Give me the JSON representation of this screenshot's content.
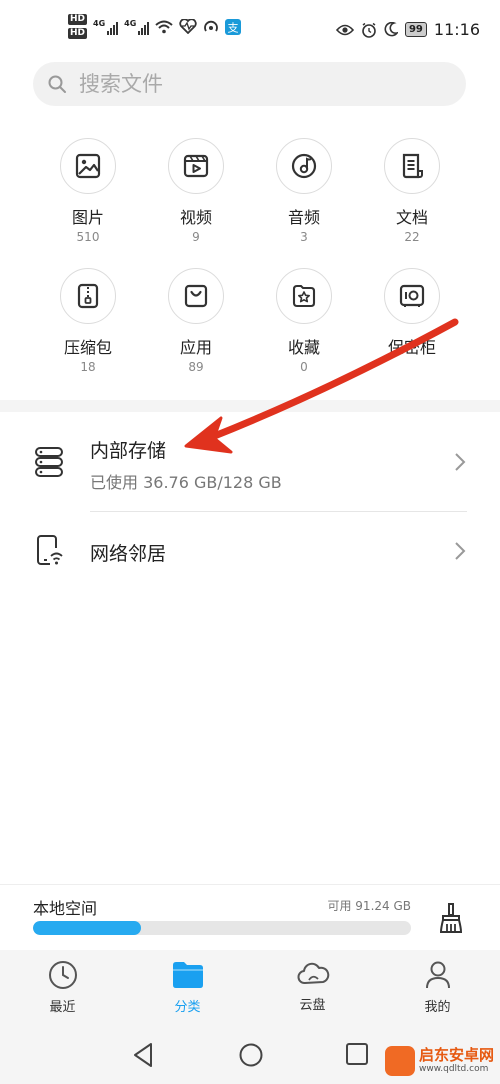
{
  "status_bar": {
    "hd1": "HD",
    "hd2": "HD",
    "net1": "4G",
    "net2": "4G",
    "battery": "99",
    "time": "11:16"
  },
  "search": {
    "placeholder": "搜索文件"
  },
  "categories": [
    {
      "name": "图片",
      "count": "510",
      "icon": "image-icon"
    },
    {
      "name": "视频",
      "count": "9",
      "icon": "video-icon"
    },
    {
      "name": "音频",
      "count": "3",
      "icon": "audio-icon"
    },
    {
      "name": "文档",
      "count": "22",
      "icon": "document-icon"
    },
    {
      "name": "压缩包",
      "count": "18",
      "icon": "archive-icon"
    },
    {
      "name": "应用",
      "count": "89",
      "icon": "app-bag-icon"
    },
    {
      "name": "收藏",
      "count": "0",
      "icon": "favorite-star-icon"
    },
    {
      "name": "保密柜",
      "count": "",
      "icon": "safe-icon"
    }
  ],
  "storage": {
    "internal_title": "内部存储",
    "internal_usage": "已使用 36.76 GB/128 GB",
    "network_title": "网络邻居"
  },
  "local_space": {
    "label": "本地空间",
    "free": "可用 91.24 GB",
    "used_fraction": 0.287
  },
  "bottom_nav": [
    {
      "label": "最近",
      "icon": "clock-icon",
      "active": false
    },
    {
      "label": "分类",
      "icon": "folder-icon",
      "active": true
    },
    {
      "label": "云盘",
      "icon": "cloud-icon",
      "active": false
    },
    {
      "label": "我的",
      "icon": "person-icon",
      "active": false
    }
  ],
  "watermark": {
    "title": "启东安卓网",
    "url": "www.qdltd.com"
  },
  "colors": {
    "accent": "#1aa0f0",
    "progress": "#27aaf0",
    "arrow": "#e0321e"
  }
}
